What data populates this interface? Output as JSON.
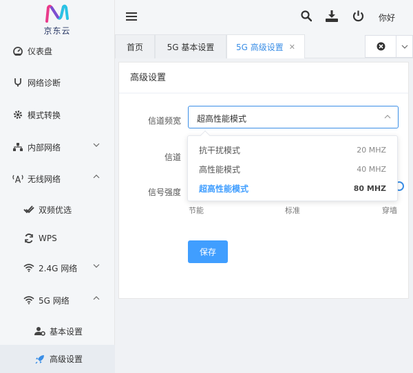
{
  "brand": {
    "name": "京东云",
    "logo_colors": [
      "#e93b8b",
      "#7b4fd1",
      "#2ac3e5"
    ]
  },
  "header": {
    "greeting": "你好",
    "icons": [
      "menu-icon",
      "search-icon",
      "download-icon",
      "power-icon"
    ]
  },
  "sidebar": {
    "items": [
      {
        "label": "仪表盘",
        "icon": "dashboard-icon"
      },
      {
        "label": "网络诊断",
        "icon": "stethoscope-icon"
      },
      {
        "label": "模式转换",
        "icon": "cog-icon"
      },
      {
        "label": "内部网络",
        "icon": "network-icon"
      },
      {
        "label": "无线网络",
        "icon": "antenna-icon"
      },
      {
        "label": "双频优选",
        "icon": "double-check-icon"
      },
      {
        "label": "WPS",
        "icon": "sync-icon"
      },
      {
        "label": "2.4G 网络",
        "icon": "wifi-icon"
      },
      {
        "label": "5G 网络",
        "icon": "wifi-icon"
      },
      {
        "label": "基本设置",
        "icon": "user-gear-icon"
      },
      {
        "label": "高级设置",
        "icon": "rocket-icon"
      }
    ]
  },
  "tabs": [
    {
      "label": "首页"
    },
    {
      "label": "5G 基本设置"
    },
    {
      "label": "5G 高级设置"
    }
  ],
  "main": {
    "card_title": "高级设置",
    "form": {
      "bandwidth_label": "信道频宽",
      "bandwidth_value": "超高性能模式",
      "channel_label": "信道",
      "signal_label": "信号强度",
      "signal_levels": [
        "节能",
        "标准",
        "穿墙"
      ]
    },
    "save_label": "保存"
  },
  "dropdown": {
    "options": [
      {
        "label": "抗干扰模式",
        "value": "20 MHZ"
      },
      {
        "label": "高性能模式",
        "value": "40 MHZ"
      },
      {
        "label": "超高性能模式",
        "value": "80 MHZ",
        "selected": true
      }
    ]
  },
  "accent_color": "#409eff"
}
